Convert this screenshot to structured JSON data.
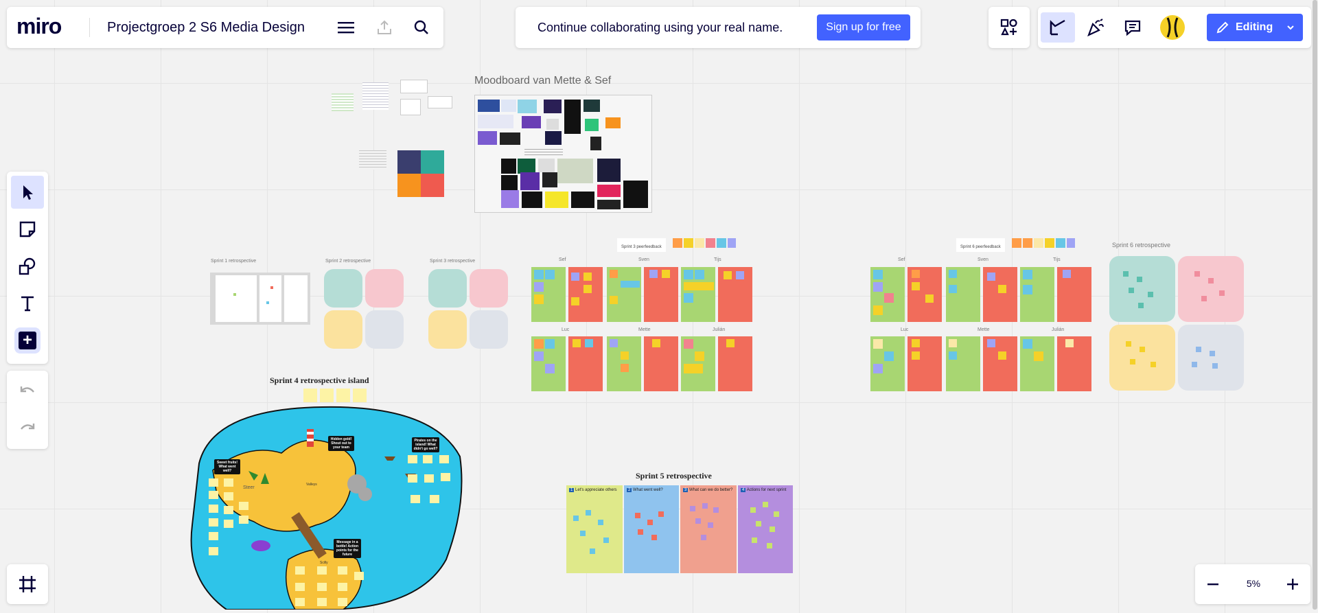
{
  "app": {
    "logo": "miro",
    "board_title": "Projectgroep 2 S6 Media Design"
  },
  "banner": {
    "message": "Continue collaborating using your real name.",
    "signup_label": "Sign up for free"
  },
  "editing": {
    "label": "Editing"
  },
  "zoom": {
    "level": "5%"
  },
  "canvas": {
    "moodboard_title": "Moodboard van Mette & Sef",
    "sprint1_label": "Sprint 1 retrospective",
    "sprint2_label": "Sprint 2 retrospective",
    "sprint3_label": "Sprint 3 retrospective",
    "sprint3_peer_label": "Sprint 3 peerfeedback",
    "sprint4_title": "Sprint 4 retrospective island",
    "sprint5_title": "Sprint 5 retrospective",
    "sprint6_peer_label": "Sprint 6 peerfeedback",
    "sprint6_retro_label": "Sprint 6 retrospective",
    "sprint5_columns": [
      "Let's appreciate others",
      "What went well?",
      "What can we do better?",
      "Actions for next sprint"
    ],
    "sprint5_numbers": [
      "1",
      "2",
      "3",
      "4"
    ],
    "peer_names_top": [
      "Sef",
      "Sven",
      "Tijs"
    ],
    "peer_names_bottom": [
      "Luc",
      "Mette",
      "Julián"
    ],
    "island_sign_sweet": "Sweet fruits! What went well?",
    "island_sign_hidden": "Hidden gold! Shout out to your team",
    "island_sign_pirates": "Pirates on the island! What didn't go well?",
    "island_sign_message": "Message in a bottle! Action points for the future",
    "island_steer": "Steer",
    "island_valleys": "Valleys",
    "island_treasure": "Scilly"
  },
  "colors": {
    "accent": "#4262ff",
    "sticky_yellow": "#f5d128",
    "sticky_green": "#a8d672",
    "sticky_red": "#f16c5b",
    "sticky_blue": "#67c6e6",
    "sticky_orange": "#ff9d48",
    "sea": "#2ec4e9"
  }
}
